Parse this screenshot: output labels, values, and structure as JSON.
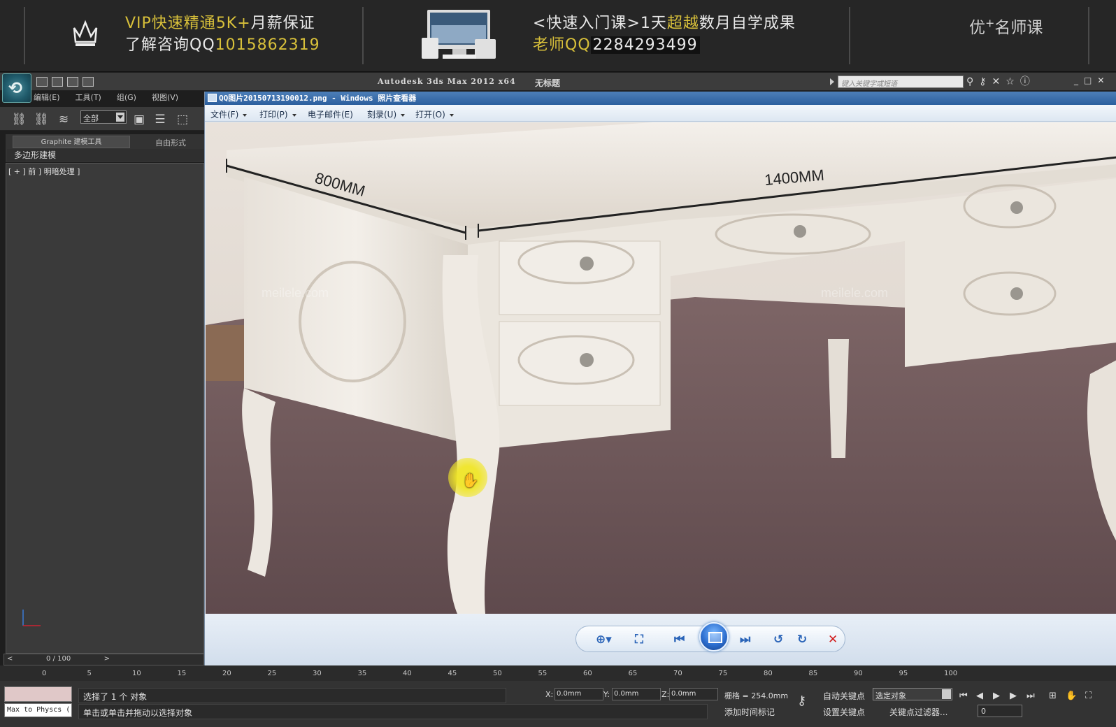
{
  "banner": {
    "left_line1_a": "VIP快速精通",
    "left_line1_b": "5K+",
    "left_line1_c": "月薪保证",
    "left_line2_a": "了解咨询QQ",
    "left_line2_b": "1015862319",
    "right_line1_a": "<快速入门课>1天",
    "right_line1_b": "超越",
    "right_line1_c": "数月自学成果",
    "right_line2_a": "老师QQ",
    "right_line2_b": "2284293499",
    "brand_a": "优",
    "brand_sup": "+",
    "brand_b": "名师课"
  },
  "max": {
    "title": "Autodesk 3ds Max  2012 x64",
    "doc": "无标题",
    "search_placeholder": "键入关键字或短语",
    "menu": [
      "编辑(E)",
      "工具(T)",
      "组(G)",
      "视图(V)"
    ],
    "selection_filter": "全部",
    "ribbon_tab1": "Graphite 建模工具",
    "ribbon_tab2": "自由形式",
    "ribbon_sub": "多边形建模",
    "viewport_label": "[ + ] 前 ] 明暗处理 ]",
    "time_slider": "0 / 100",
    "time_left": "<",
    "time_right": ">"
  },
  "viewer": {
    "title": "QQ图片20150713190012.png - Windows 照片查看器",
    "menu": [
      "文件(F)",
      "打印(P)",
      "电子邮件(E)",
      "刻录(U)",
      "打开(O)"
    ],
    "dimension_1": "800MM",
    "dimension_2": "1400MM",
    "watermark": "meilele.com"
  },
  "timeline": {
    "ticks": [
      "0",
      "5",
      "10",
      "15",
      "20",
      "25",
      "30",
      "35",
      "40",
      "45",
      "50",
      "55",
      "60",
      "65",
      "70",
      "75",
      "80",
      "85",
      "90",
      "95",
      "100"
    ]
  },
  "status": {
    "script_label": "Max to Physcs (",
    "selected": "选择了 1 个 对象",
    "prompt": "单击或单击并拖动以选择对象",
    "x_label": "X:",
    "x_value": "0.0mm",
    "y_label": "Y:",
    "y_value": "0.0mm",
    "z_label": "Z:",
    "z_value": "0.0mm",
    "grid": "栅格 = 254.0mm",
    "add_time_tag": "添加时间标记",
    "auto_key": "自动关键点",
    "set_key": "设置关键点",
    "selected_objects": "选定对象",
    "key_filter": "关键点过滤器...",
    "frame": "0"
  },
  "colors": {
    "banner_bg": "#262626",
    "banner_yellow": "#d8c03a",
    "viewer_title": "#2c5f9e",
    "nav_blue": "#2a64b8",
    "close_red": "#d01a1a"
  }
}
